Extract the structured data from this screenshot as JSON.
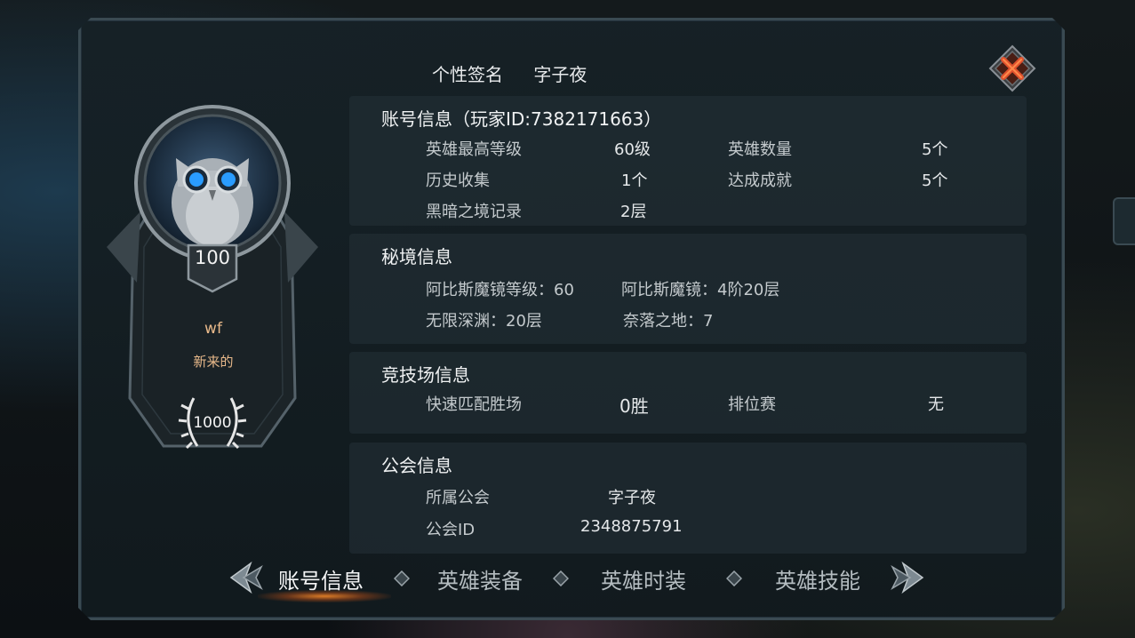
{
  "header": {
    "signature_label": "个性签名",
    "signature_value": "字子夜"
  },
  "profile": {
    "level": "100",
    "name": "wf",
    "title": "新来的",
    "rank_points": "1000"
  },
  "account": {
    "title": "账号信息（玩家ID:7382171663）",
    "rows": [
      {
        "label": "英雄最高等级",
        "value": "60级",
        "label2": "英雄数量",
        "value2": "5个"
      },
      {
        "label": "历史收集",
        "value": "1个",
        "label2": "达成成就",
        "value2": "5个"
      },
      {
        "label": "黑暗之境记录",
        "value": "2层"
      }
    ]
  },
  "secret": {
    "title": "秘境信息",
    "items": [
      "阿比斯魔镜等级：60",
      "阿比斯魔镜：4阶20层",
      "无限深渊：20层",
      "奈落之地：7"
    ]
  },
  "arena": {
    "title": "竞技场信息",
    "quick_label": "快速匹配胜场",
    "quick_value": "0胜",
    "ranked_label": "排位赛",
    "ranked_value": "无"
  },
  "guild": {
    "title": "公会信息",
    "name_label": "所属公会",
    "name_value": "字子夜",
    "id_label": "公会ID",
    "id_value": "2348875791"
  },
  "tabs": [
    "账号信息",
    "英雄装备",
    "英雄时装",
    "英雄技能"
  ],
  "icons": {
    "close": "close-x-icon",
    "prev": "arrow-left-icon",
    "next": "arrow-right-icon",
    "avatar": "owl-avatar-icon",
    "laurel": "laurel-wreath-icon"
  },
  "colors": {
    "accent_orange": "#e8b98a",
    "close_red": "#d2472a",
    "tab_glow": "#ff8c28"
  }
}
